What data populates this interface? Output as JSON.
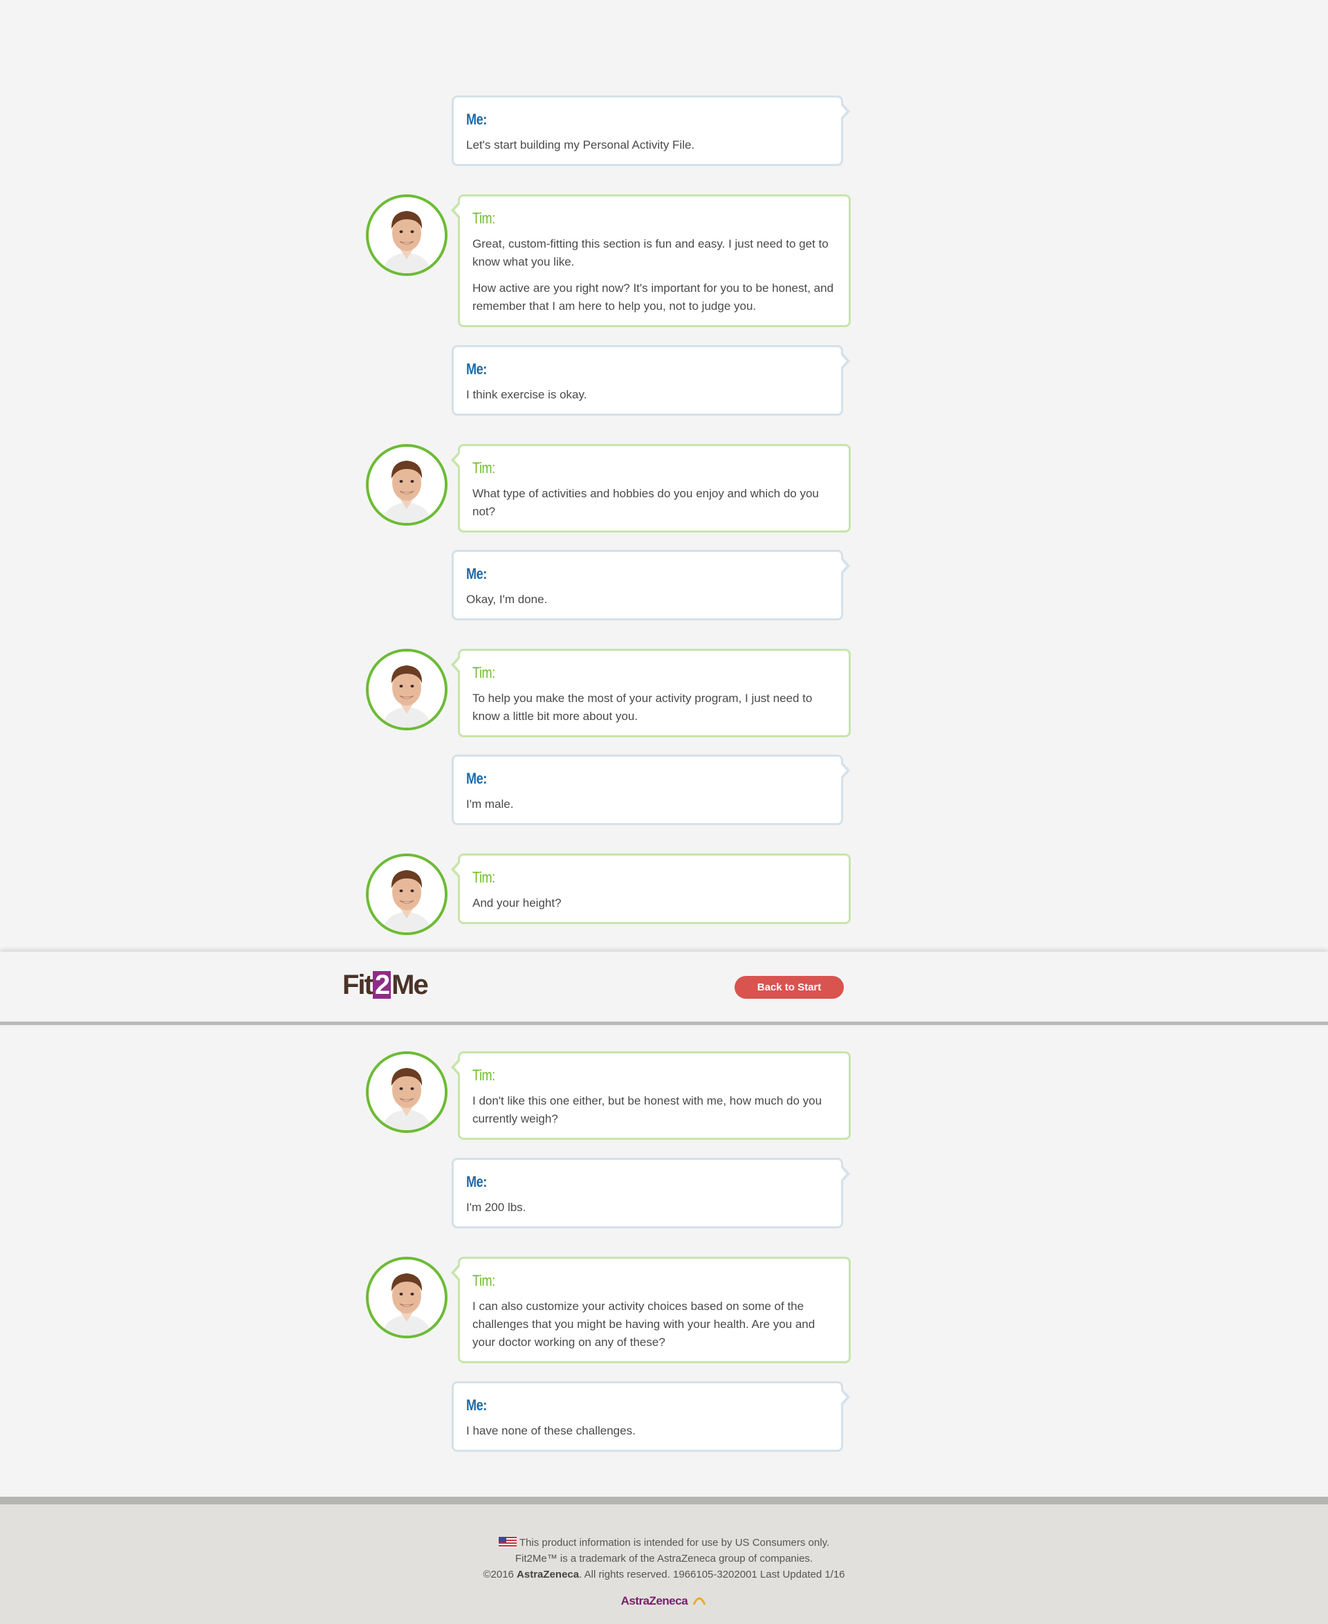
{
  "conversation": {
    "messages": [
      {
        "speaker": "Me:",
        "text": [
          "Let's start building my Personal Activity File."
        ]
      },
      {
        "speaker": "Tim:",
        "text": [
          "Great, custom-fitting this section is fun and easy. I just need to get to know what you like.",
          "How active are you right now? It's important for you to be honest, and remember that I am here to help you, not to judge you."
        ]
      },
      {
        "speaker": "Me:",
        "text": [
          "I think exercise is okay."
        ]
      },
      {
        "speaker": "Tim:",
        "text": [
          "What type of activities and hobbies do you enjoy and which do you not?"
        ]
      },
      {
        "speaker": "Me:",
        "text": [
          "Okay, I'm done."
        ]
      },
      {
        "speaker": "Tim:",
        "text": [
          "To help you make the most of your activity program, I just need to know a little bit more about you."
        ]
      },
      {
        "speaker": "Me:",
        "text": [
          "I'm male."
        ]
      },
      {
        "speaker": "Tim:",
        "text": [
          "And your height?"
        ]
      },
      {
        "speaker": "Tim:",
        "text": [
          "I don't like this one either, but be honest with me, how much do you currently weigh?"
        ]
      },
      {
        "speaker": "Me:",
        "text": [
          "I'm 200 lbs."
        ]
      },
      {
        "speaker": "Tim:",
        "text": [
          "I can also customize your activity choices based on some of the challenges that you might be having with your health. Are you and your doctor working on any of these?"
        ]
      },
      {
        "speaker": "Me:",
        "text": [
          "I have none of these challenges."
        ]
      }
    ]
  },
  "header": {
    "logo_prefix": "Fit",
    "logo_mark": "2",
    "logo_suffix": "Me",
    "back_button": "Back to Start"
  },
  "footer": {
    "flag_icon": "us-flag-icon",
    "line1": "This product information is intended for use by US Consumers only.",
    "line2": "Fit2Me™ is a trademark of the AstraZeneca group of companies.",
    "line3_prefix": "©2016 ",
    "line3_brand": "AstraZeneca",
    "line3_suffix": ". All rights reserved. 1966105-3202001 Last Updated 1/16",
    "logo_text": "AstraZeneca"
  },
  "colors": {
    "me_accent": "#1e6aa8",
    "tim_accent": "#6fbb2e",
    "button": "#d9534f",
    "logo_mark": "#8e2d86"
  }
}
